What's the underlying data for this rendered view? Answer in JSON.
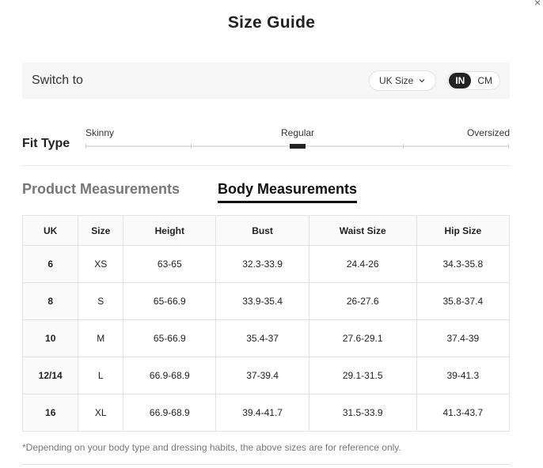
{
  "modal": {
    "close_glyph": "×",
    "title": "Size Guide"
  },
  "switch_bar": {
    "label": "Switch to",
    "size_select_value": "UK Size",
    "units": [
      "IN",
      "CM"
    ],
    "active_unit": "IN"
  },
  "fit": {
    "title": "Fit Type",
    "labels": [
      "Skinny",
      "Regular",
      "Oversized"
    ],
    "selected": "Regular"
  },
  "tabs": {
    "product": "Product Measurements",
    "body": "Body Measurements",
    "active": "Body Measurements"
  },
  "table": {
    "headers": [
      "UK",
      "Size",
      "Height",
      "Bust",
      "Waist Size",
      "Hip Size"
    ],
    "rows": [
      [
        "6",
        "XS",
        "63-65",
        "32.3-33.9",
        "24.4-26",
        "34.3-35.8"
      ],
      [
        "8",
        "S",
        "65-66.9",
        "33.9-35.4",
        "26-27.6",
        "35.8-37.4"
      ],
      [
        "10",
        "M",
        "65-66.9",
        "35.4-37",
        "27.6-29.1",
        "37.4-39"
      ],
      [
        "12/14",
        "L",
        "66.9-68.9",
        "37-39.4",
        "29.1-31.5",
        "39-41.3"
      ],
      [
        "16",
        "XL",
        "66.9-68.9",
        "39.4-41.7",
        "31.5-33.9",
        "41.3-43.7"
      ]
    ]
  },
  "footnote": "*Depending on your body type and dressing habits, the above sizes are for reference only."
}
